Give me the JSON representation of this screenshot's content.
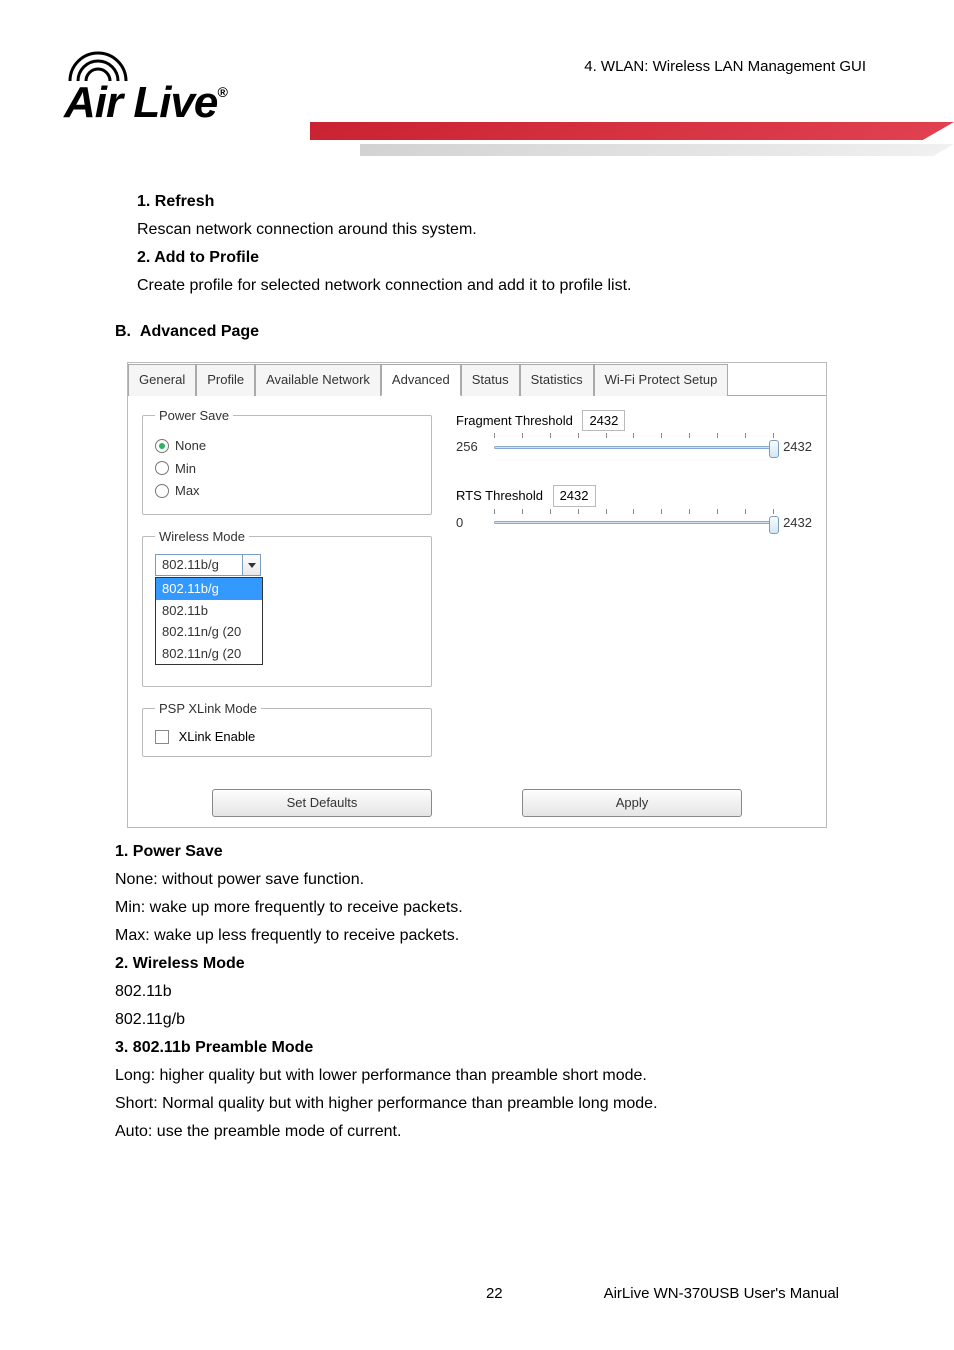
{
  "header": {
    "chapter_title": "4. WLAN: Wireless LAN Management GUI",
    "logo_text": "Air Live",
    "logo_reg": "®"
  },
  "sections": {
    "refresh": {
      "title": "1. Refresh",
      "body": "Rescan network connection around this system."
    },
    "add_profile": {
      "title": "2. Add to Profile",
      "body": "Create profile for selected network connection and add it to profile list."
    },
    "advanced": {
      "letter": "B.",
      "title": "Advanced Page"
    },
    "power_save": {
      "title": "1. Power Save",
      "none": "None: without power save function.",
      "min": "Min: wake up more frequently to receive packets.",
      "max": "Max: wake up less frequently to receive packets."
    },
    "wireless_mode": {
      "title": "2. Wireless Mode",
      "line1": "802.11b",
      "line2": "802.11g/b"
    },
    "preamble": {
      "title": "3. 802.11b Preamble Mode",
      "long": "Long: higher quality but with lower performance than preamble short mode.",
      "short": "Short: Normal quality but with higher performance than preamble long mode.",
      "auto": "Auto: use the preamble mode of current."
    }
  },
  "dialog": {
    "tabs": [
      "General",
      "Profile",
      "Available Network",
      "Advanced",
      "Status",
      "Statistics",
      "Wi-Fi Protect Setup"
    ],
    "active_tab": "Advanced",
    "power_save": {
      "legend": "Power Save",
      "options": [
        "None",
        "Min",
        "Max"
      ],
      "selected": "None"
    },
    "wireless_mode": {
      "legend": "Wireless Mode",
      "selected": "802.11b/g",
      "dropdown": [
        "802.11b/g",
        "802.11b",
        "802.11n/g (20",
        "802.11n/g (20"
      ],
      "highlighted": "802.11b/g"
    },
    "psp": {
      "legend": "PSP XLink Mode",
      "checkbox_label": "XLink Enable",
      "checked": false
    },
    "fragment": {
      "label": "Fragment Threshold",
      "value": "2432",
      "min": "256",
      "max": "2432"
    },
    "rts": {
      "label": "RTS Threshold",
      "value": "2432",
      "min": "0",
      "max": "2432"
    },
    "buttons": {
      "defaults": "Set Defaults",
      "apply": "Apply"
    }
  },
  "footer": {
    "page": "22",
    "manual": "AirLive WN-370USB User's Manual"
  }
}
